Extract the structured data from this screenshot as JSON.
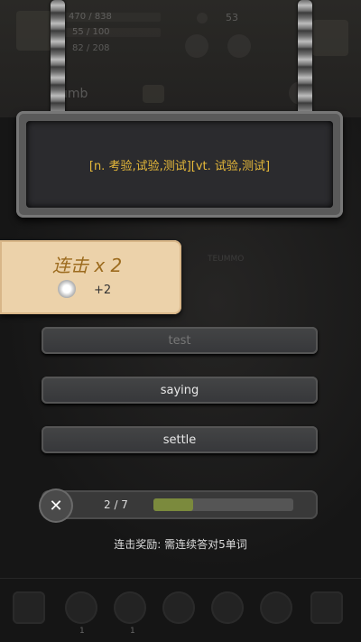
{
  "hud": {
    "stat1": "470 / 838",
    "stat2": "55 / 100",
    "stat3": "82 / 208",
    "coins": "53",
    "tab_label": "umb"
  },
  "question": {
    "definition": "[n. 考验,试验,测试][vt. 试验,测试]"
  },
  "combo": {
    "title": "连击 x 2",
    "bonus": "+2",
    "faded_text": "TEUMMO"
  },
  "options": [
    {
      "label": "test",
      "state": "selected-dim"
    },
    {
      "label": "saying",
      "state": "normal"
    },
    {
      "label": "settle",
      "state": "normal"
    }
  ],
  "progress": {
    "text": "2 / 7",
    "current": 2,
    "total": 7
  },
  "hint": "连击奖励: 需连续答对5单词",
  "close_icon": "✕",
  "bottom_counts": [
    "1",
    "1"
  ]
}
